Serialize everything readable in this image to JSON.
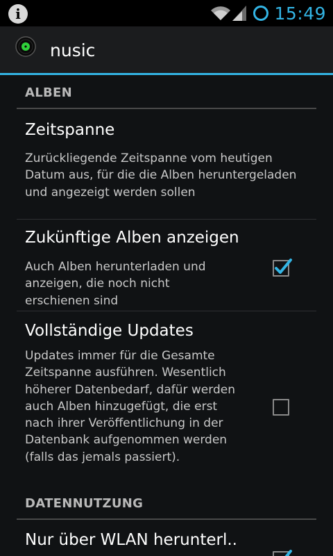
{
  "status_bar": {
    "time": "15:49",
    "accent_color": "#33b5e5",
    "info_icon_glyph": "i",
    "icons": [
      "info-icon",
      "wifi-icon",
      "signal-icon",
      "sync-icon"
    ]
  },
  "action_bar": {
    "title": "nusic",
    "icon": "vinyl-record-icon"
  },
  "sections": [
    {
      "header": "ALBEN",
      "preferences": [
        {
          "title": "Zeitspanne",
          "summary": "Zurückliegende Zeitspanne vom heutigen Datum aus, für die die Alben heruntergeladen und angezeigt werden sollen"
        },
        {
          "title": "Zukünftige Alben anzeigen",
          "summary": "Auch Alben herunterladen und anzeigen, die noch nicht erschienen sind",
          "checked": true
        },
        {
          "title": "Vollständige Updates",
          "summary": "Updates immer für die Gesamte Zeitspanne ausführen. Wesentlich höherer Datenbedarf, dafür werden auch Alben hinzugefügt, die erst nach ihrer Veröffentlichung in der Datenbank aufgenommen werden (falls das jemals passiert).",
          "checked": false
        }
      ]
    },
    {
      "header": "DATENNUTZUNG",
      "preferences": [
        {
          "title": "Nur über WLAN herunterl..",
          "checked": true
        }
      ]
    }
  ]
}
